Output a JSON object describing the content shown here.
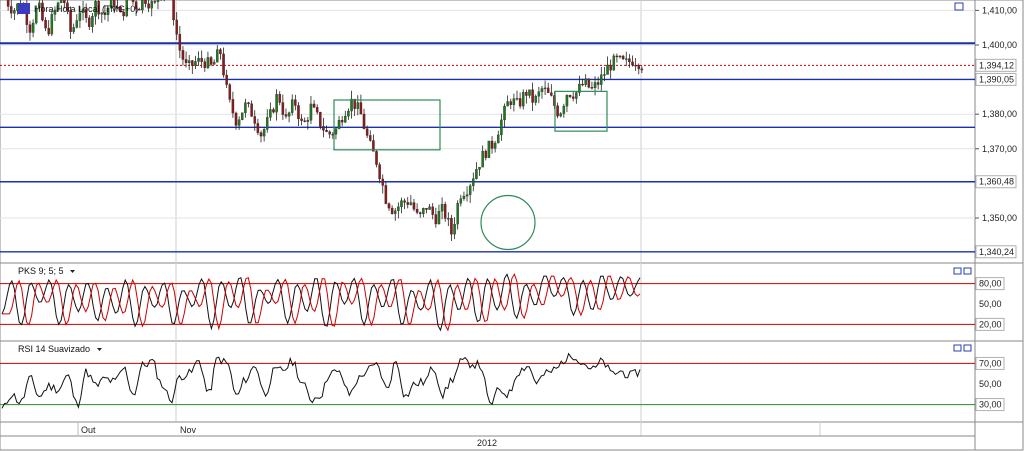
{
  "chart_data": [
    {
      "type": "candlestick",
      "title": "Hora Hora Local (TMG+0)",
      "symbol_icon": "instrument-icon",
      "ylim": [
        1.337,
        1.413
      ],
      "y_ticks": [
        "1,410,00",
        "1,400,00",
        "1,380,00",
        "1,370,00",
        "1,350,00"
      ],
      "y_tick_values": [
        1.41,
        1.4,
        1.38,
        1.37,
        1.35
      ],
      "current_price": {
        "value": 1.39412,
        "label": "1,394,12",
        "color": "#cc0000"
      },
      "horizontal_levels": [
        {
          "value": 1.4005,
          "label": ""
        },
        {
          "value": 1.39005,
          "label": "1,390,05"
        },
        {
          "value": 1.3762,
          "label": ""
        },
        {
          "value": 1.36048,
          "label": "1,360,48"
        },
        {
          "value": 1.34024,
          "label": "1,340,24"
        }
      ],
      "level_color": "#1a2fb0",
      "annotations": [
        {
          "shape": "rectangle",
          "color": "#2e8b57"
        },
        {
          "shape": "rectangle",
          "color": "#2e8b57"
        },
        {
          "shape": "circle",
          "color": "#2e8b57"
        }
      ],
      "price_path": [
        1.4135,
        1.41,
        1.4125,
        1.405,
        1.4115,
        1.403,
        1.4095,
        1.4145,
        1.403,
        1.4105,
        1.406,
        1.412,
        1.4085,
        1.4135,
        1.408,
        1.414,
        1.411,
        1.4135,
        1.411,
        1.4165,
        1.4145,
        1.3995,
        1.393,
        1.395,
        1.3955,
        1.3935,
        1.3985,
        1.384,
        1.378,
        1.3825,
        1.38,
        1.374,
        1.379,
        1.386,
        1.378,
        1.384,
        1.376,
        1.382,
        1.378,
        1.374,
        1.3755,
        1.381,
        1.384,
        1.38,
        1.3715,
        1.366,
        1.356,
        1.352,
        1.3545,
        1.355,
        1.3495,
        1.3535,
        1.35,
        1.3525,
        1.3455,
        1.357,
        1.359,
        1.3645,
        1.369,
        1.3715,
        1.378,
        1.3845,
        1.3825,
        1.3865,
        1.3835,
        1.3875,
        1.3845,
        1.38,
        1.3865,
        1.386,
        1.389,
        1.387,
        1.39,
        1.394,
        1.3955,
        1.3945,
        1.396,
        1.3945
      ]
    },
    {
      "type": "line",
      "title": "PKS 9; 5; 5",
      "ylim": [
        0,
        100
      ],
      "levels": [
        {
          "value": 80,
          "label": "80,00",
          "color": "#cc0000"
        },
        {
          "value": 50,
          "label": "50,00",
          "color": ""
        },
        {
          "value": 20,
          "label": "20,00",
          "color": "#cc0000"
        }
      ],
      "series_colors": [
        "#000000",
        "#cc0000"
      ],
      "values": [
        35,
        85,
        18,
        80,
        52,
        85,
        20,
        78,
        40,
        82,
        25,
        74,
        35,
        85,
        18,
        76,
        44,
        82,
        20,
        72,
        46,
        88,
        15,
        84,
        44,
        90,
        20,
        72,
        52,
        85,
        22,
        80,
        38,
        90,
        15,
        82,
        50,
        88,
        20,
        78,
        45,
        88,
        20,
        70,
        40,
        84,
        12,
        78,
        40,
        88,
        22,
        86,
        40,
        95,
        30,
        80,
        48,
        92,
        60,
        90,
        35,
        85,
        40,
        92,
        55,
        90,
        60,
        88
      ]
    },
    {
      "type": "line",
      "title": "RSI 14 Suavizado",
      "ylim": [
        15,
        85
      ],
      "levels": [
        {
          "value": 70,
          "label": "70,00",
          "color": "#cc0000"
        },
        {
          "value": 50,
          "label": "50,00",
          "color": ""
        },
        {
          "value": 30,
          "label": "30,00",
          "color": "#2a8a2a"
        }
      ],
      "values": [
        25,
        40,
        32,
        55,
        38,
        48,
        45,
        58,
        30,
        62,
        48,
        55,
        52,
        65,
        40,
        68,
        72,
        50,
        35,
        58,
        60,
        73,
        40,
        75,
        70,
        38,
        55,
        68,
        40,
        62,
        64,
        72,
        50,
        35,
        40,
        62,
        60,
        40,
        55,
        64,
        68,
        45,
        72,
        38,
        50,
        52,
        66,
        40,
        55,
        72,
        70,
        68,
        30,
        44,
        40,
        62,
        68,
        52,
        60,
        64,
        74,
        78,
        70,
        64,
        72,
        60,
        62,
        58,
        62
      ]
    }
  ],
  "time_axis": {
    "labels": [
      "Out",
      "Nov"
    ],
    "year_label": "2012"
  },
  "panels": {
    "indicator1_menu_icon": "dropdown-arrow-icon",
    "indicator2_menu_icon": "dropdown-arrow-icon",
    "window_icons": [
      "minimize-icon",
      "maximize-icon"
    ]
  }
}
